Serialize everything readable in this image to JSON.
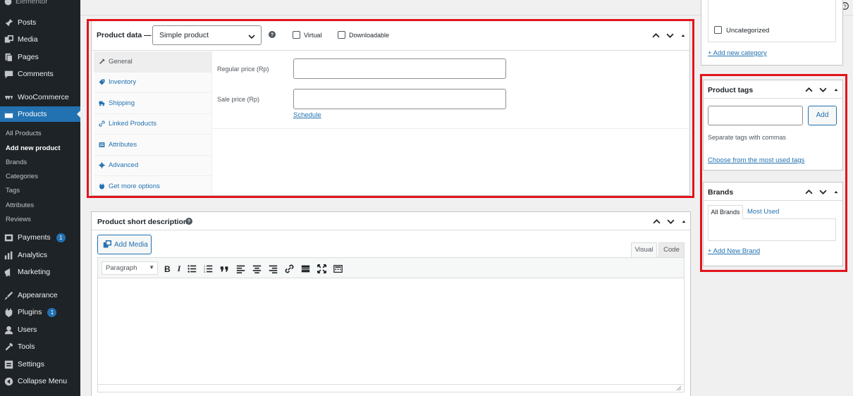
{
  "sidebar": {
    "top_partial": "Elementor",
    "items": [
      {
        "label": "Posts",
        "icon": "pin-icon"
      },
      {
        "label": "Media",
        "icon": "media-icon"
      },
      {
        "label": "Pages",
        "icon": "pages-icon"
      },
      {
        "label": "Comments",
        "icon": "comments-icon"
      },
      {
        "label": "WooCommerce",
        "icon": "woocommerce-icon"
      },
      {
        "label": "Products",
        "icon": "products-icon"
      },
      {
        "label": "Payments",
        "icon": "payments-icon",
        "badge": "1"
      },
      {
        "label": "Analytics",
        "icon": "analytics-icon"
      },
      {
        "label": "Marketing",
        "icon": "marketing-icon"
      },
      {
        "label": "Appearance",
        "icon": "appearance-icon"
      },
      {
        "label": "Plugins",
        "icon": "plugins-icon",
        "badge": "1"
      },
      {
        "label": "Users",
        "icon": "users-icon"
      },
      {
        "label": "Tools",
        "icon": "tools-icon"
      },
      {
        "label": "Settings",
        "icon": "settings-icon"
      },
      {
        "label": "Collapse Menu",
        "icon": "collapse-icon"
      }
    ],
    "submenu": [
      "All Products",
      "Add new product",
      "Brands",
      "Categories",
      "Tags",
      "Attributes",
      "Reviews"
    ]
  },
  "product_data": {
    "title": "Product data —",
    "type_select": "Simple product",
    "virtual_label": "Virtual",
    "downloadable_label": "Downloadable",
    "tabs": [
      "General",
      "Inventory",
      "Shipping",
      "Linked Products",
      "Attributes",
      "Advanced",
      "Get more options"
    ],
    "regular_price_label": "Regular price (Rp)",
    "sale_price_label": "Sale price (Rp)",
    "schedule_link": "Schedule"
  },
  "short_description": {
    "title": "Product short description",
    "add_media": "Add Media",
    "tab_visual": "Visual",
    "tab_code": "Code",
    "format_select": "Paragraph"
  },
  "categories": {
    "item": "Uncategorized",
    "add_link": "+ Add new category"
  },
  "product_tags": {
    "title": "Product tags",
    "add_button": "Add",
    "hint": "Separate tags with commas",
    "choose_link": "Choose from the most used tags"
  },
  "brands": {
    "title": "Brands",
    "tab_all": "All Brands",
    "tab_most": "Most Used",
    "add_link": "+ Add New Brand"
  },
  "colors": {
    "accent": "#2271b1",
    "highlight": "#e3141b",
    "sidebar_bg": "#1d2327"
  }
}
